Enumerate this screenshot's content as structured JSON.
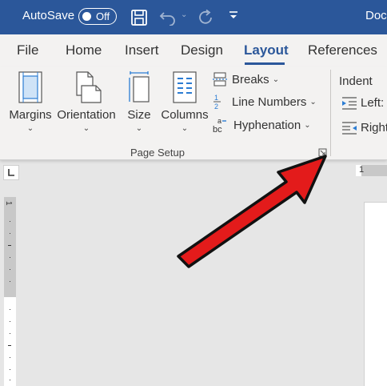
{
  "titlebar": {
    "autosave_label": "AutoSave",
    "autosave_state": "Off",
    "doc_title": "Doc",
    "save_icon": "save-icon",
    "undo_icon": "undo-icon",
    "redo_icon": "redo-icon",
    "customize_icon": "customize-qat-icon",
    "bg_color": "#2b579a"
  },
  "tabs": [
    {
      "label": "File"
    },
    {
      "label": "Home"
    },
    {
      "label": "Insert"
    },
    {
      "label": "Design"
    },
    {
      "label": "Layout",
      "active": true
    },
    {
      "label": "References"
    }
  ],
  "page_setup": {
    "group_label": "Page Setup",
    "margins": "Margins",
    "orientation": "Orientation",
    "size": "Size",
    "columns": "Columns",
    "breaks": "Breaks",
    "line_numbers": "Line Numbers",
    "hyphenation": "Hyphenation"
  },
  "paragraph": {
    "indent_label": "Indent",
    "left_label": "Left:",
    "right_label": "Right"
  },
  "ruler": {
    "h_mark": "1",
    "v_mark": "1"
  },
  "annotation": {
    "arrow_color": "#e31b1b"
  }
}
